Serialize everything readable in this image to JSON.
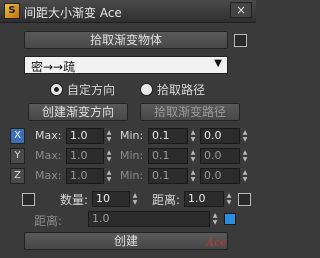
{
  "window": {
    "title": "间距大小渐变 Ace",
    "icon": "script-icon",
    "close_label": "×"
  },
  "pick_object_button": "拾取渐变物体",
  "dropdown": {
    "selected": "密→→疏",
    "arrow": "▼"
  },
  "radios": [
    {
      "label": "自定方向",
      "selected": true
    },
    {
      "label": "拾取路径",
      "selected": false
    }
  ],
  "create_direction_button": "创建渐变方向",
  "pick_path_button": "拾取渐变路径",
  "axes": [
    {
      "axis": "X",
      "active": true,
      "max_label": "Max:",
      "max": "1.0",
      "min_label": "Min:",
      "min": "0.1",
      "extra": "0.0"
    },
    {
      "axis": "Y",
      "active": false,
      "max_label": "Max:",
      "max": "1.0",
      "min_label": "Min:",
      "min": "0.1",
      "extra": "0.0"
    },
    {
      "axis": "Z",
      "active": false,
      "max_label": "Max:",
      "max": "1.0",
      "min_label": "Min:",
      "min": "0.1",
      "extra": "0.0"
    }
  ],
  "count": {
    "label": "数量:",
    "value": "10"
  },
  "distance": {
    "label": "距离:",
    "value": "1.0"
  },
  "distance2": {
    "label": "距离:",
    "value": "1.0",
    "swatch_color": "#2a8ee0"
  },
  "create_button": "创建",
  "watermark": "Ace"
}
